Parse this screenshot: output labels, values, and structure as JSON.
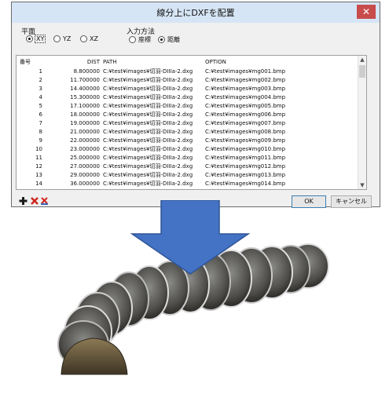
{
  "dialog": {
    "title": "線分上にDXFを配置",
    "close_glyph": "✕",
    "plane": {
      "label": "平面",
      "options": [
        {
          "label": "XY",
          "selected": true
        },
        {
          "label": "YZ",
          "selected": false
        },
        {
          "label": "XZ",
          "selected": false
        }
      ]
    },
    "input_method": {
      "label": "入力方法",
      "options": [
        {
          "label": "座標",
          "selected": false
        },
        {
          "label": "距離",
          "selected": true
        }
      ]
    },
    "table": {
      "headers": {
        "num": "番号",
        "dist": "DIST",
        "path": "PATH",
        "option": "OPTION"
      },
      "rows": [
        {
          "num": "1",
          "dist": "8.800000",
          "path": "C:¥test¥images¥切羽-DIIIa-2.dxg",
          "option": "C:¥test¥images¥mg001.bmp"
        },
        {
          "num": "2",
          "dist": "11.700000",
          "path": "C:¥test¥images¥切羽-DIIIa-2.dxg",
          "option": "C:¥test¥images¥mg002.bmp"
        },
        {
          "num": "3",
          "dist": "14.400000",
          "path": "C:¥test¥images¥切羽-DIIIa-2.dxg",
          "option": "C:¥test¥images¥mg003.bmp"
        },
        {
          "num": "4",
          "dist": "15.300000",
          "path": "C:¥test¥images¥切羽-DIIIa-2.dxg",
          "option": "C:¥test¥images¥mg004.bmp"
        },
        {
          "num": "5",
          "dist": "17.100000",
          "path": "C:¥test¥images¥切羽-DIIIa-2.dxg",
          "option": "C:¥test¥images¥mg005.bmp"
        },
        {
          "num": "6",
          "dist": "18.000000",
          "path": "C:¥test¥images¥切羽-DIIIa-2.dxg",
          "option": "C:¥test¥images¥mg006.bmp"
        },
        {
          "num": "7",
          "dist": "19.000000",
          "path": "C:¥test¥images¥切羽-DIIIa-2.dxg",
          "option": "C:¥test¥images¥mg007.bmp"
        },
        {
          "num": "8",
          "dist": "21.000000",
          "path": "C:¥test¥images¥切羽-DIIIa-2.dxg",
          "option": "C:¥test¥images¥mg008.bmp"
        },
        {
          "num": "9",
          "dist": "22.000000",
          "path": "C:¥test¥images¥切羽-DIIIa-2.dxg",
          "option": "C:¥test¥images¥mg009.bmp"
        },
        {
          "num": "10",
          "dist": "23.000000",
          "path": "C:¥test¥images¥切羽-DIIIa-2.dxg",
          "option": "C:¥test¥images¥mg010.bmp"
        },
        {
          "num": "11",
          "dist": "25.000000",
          "path": "C:¥test¥images¥切羽-DIIIa-2.dxg",
          "option": "C:¥test¥images¥mg011.bmp"
        },
        {
          "num": "12",
          "dist": "27.000000",
          "path": "C:¥test¥images¥切羽-DIIIa-2.dxg",
          "option": "C:¥test¥images¥mg012.bmp"
        },
        {
          "num": "13",
          "dist": "29.000000",
          "path": "C:¥test¥images¥切羽-DIIIa-2.dxg",
          "option": "C:¥test¥images¥mg013.bmp"
        },
        {
          "num": "14",
          "dist": "36.000000",
          "path": "C:¥test¥images¥切羽-DIIIa-2.dxg",
          "option": "C:¥test¥images¥mg014.bmp"
        }
      ]
    },
    "toolbar": {
      "add_icon": "plus-icon",
      "delete_icon": "delete-x-icon",
      "clear_icon": "clear-all-icon"
    },
    "ok_label": "OK",
    "cancel_label": "キャンセル"
  },
  "colors": {
    "arrow": "#4472c4",
    "titlebar": "#d6e5f5",
    "close": "#c84c4c",
    "delete": "#d0261c"
  }
}
